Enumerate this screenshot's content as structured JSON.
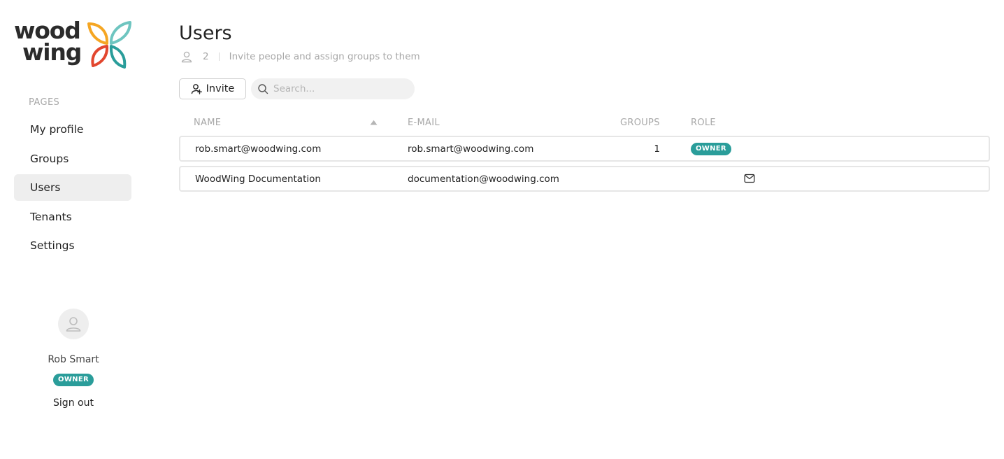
{
  "brand": {
    "logo_line1": "wood",
    "logo_line2": "wing",
    "colors": {
      "orange": "#f5a623",
      "red": "#e2462e",
      "teal": "#2a9d9a",
      "light_teal": "#6ec5c0"
    }
  },
  "sidebar": {
    "section_label": "PAGES",
    "items": [
      {
        "label": "My profile",
        "active": false,
        "icon": "none"
      },
      {
        "label": "Groups",
        "active": false,
        "icon": "none"
      },
      {
        "label": "Users",
        "active": true,
        "icon": "none"
      },
      {
        "label": "Tenants",
        "active": false,
        "icon": "none"
      },
      {
        "label": "Settings",
        "active": false,
        "icon": "none"
      }
    ],
    "user": {
      "name": "Rob Smart",
      "role_badge": "OWNER",
      "avatar_icon": "user-icon",
      "sign_out_label": "Sign out"
    }
  },
  "main": {
    "title": "Users",
    "user_count": "2",
    "subtitle": "Invite people and assign groups to them",
    "invite_label": "Invite",
    "search_placeholder": "Search...",
    "search_value": "",
    "table": {
      "columns": {
        "name": "NAME",
        "email": "E-MAIL",
        "groups": "GROUPS",
        "role": "ROLE"
      },
      "sort": {
        "column": "name",
        "direction": "ascending"
      },
      "rows": [
        {
          "name": "rob.smart@woodwing.com",
          "email": "rob.smart@woodwing.com",
          "groups": "1",
          "role": "OWNER",
          "status_icon": "none"
        },
        {
          "name": "WoodWing Documentation",
          "email": "documentation@woodwing.com",
          "groups": "",
          "role": "",
          "status_icon": "envelope-icon"
        }
      ]
    }
  },
  "accent_color": "#2a9d9a"
}
